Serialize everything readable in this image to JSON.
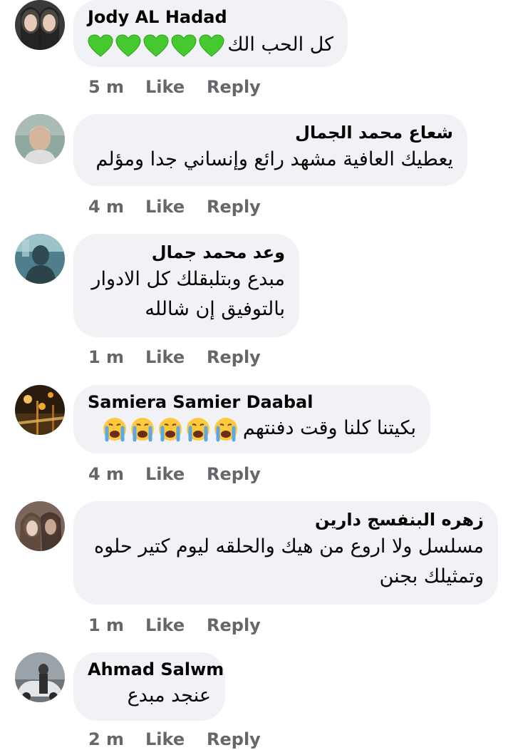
{
  "actions": {
    "like_label": "Like",
    "reply_label": "Reply"
  },
  "comments": [
    {
      "author": "Jody AL Hadad",
      "text": "كل الحب الك",
      "emoji": "green-heart-icon",
      "emoji_count": 5,
      "time": "5 m",
      "avatar_colors": [
        "#2b2b2b",
        "#d9c1b1"
      ]
    },
    {
      "author": "شعاع محمد الجمال",
      "text": "يعطيك العافية مشهد رائع وإنساني جدا ومؤلم",
      "time": "4 m",
      "avatar_colors": [
        "#8aa39a",
        "#c9b39a"
      ]
    },
    {
      "author": "وعد محمد جمال",
      "text_lines": [
        "مبدع وبتلبقلك كل الادوار",
        "بالتوفيق إن شالله"
      ],
      "time": "1 m",
      "avatar_colors": [
        "#3f6b7a",
        "#9fc1c9"
      ]
    },
    {
      "author": "Samiera Samier Daabal",
      "text": "بكيتنا كلنا وقت دفنتهم",
      "emoji": "crying-face-icon",
      "emoji_count": 5,
      "time": "4 m",
      "avatar_colors": [
        "#3a2a14",
        "#e6a23b"
      ]
    },
    {
      "author": "زهره البنفسج دارين",
      "text_lines": [
        "مسلسل ولا اروع من هيك والحلقه ليوم كتير حلوه",
        "وتمثيلك بجنن"
      ],
      "time": "1 m",
      "avatar_colors": [
        "#6e5a4e",
        "#d9bfae"
      ]
    },
    {
      "author": "Ahmad Salwm",
      "text": "عنجد مبدع",
      "time": "2 m",
      "avatar_colors": [
        "#7d8790",
        "#c7ccd0"
      ]
    }
  ],
  "colors": {
    "bubble": "#f0f2f5",
    "meta": "#65676b",
    "text": "#050505",
    "green_heart": "#45c92f",
    "cry_face": "#ffc83d",
    "tears": "#5aa9e6"
  }
}
